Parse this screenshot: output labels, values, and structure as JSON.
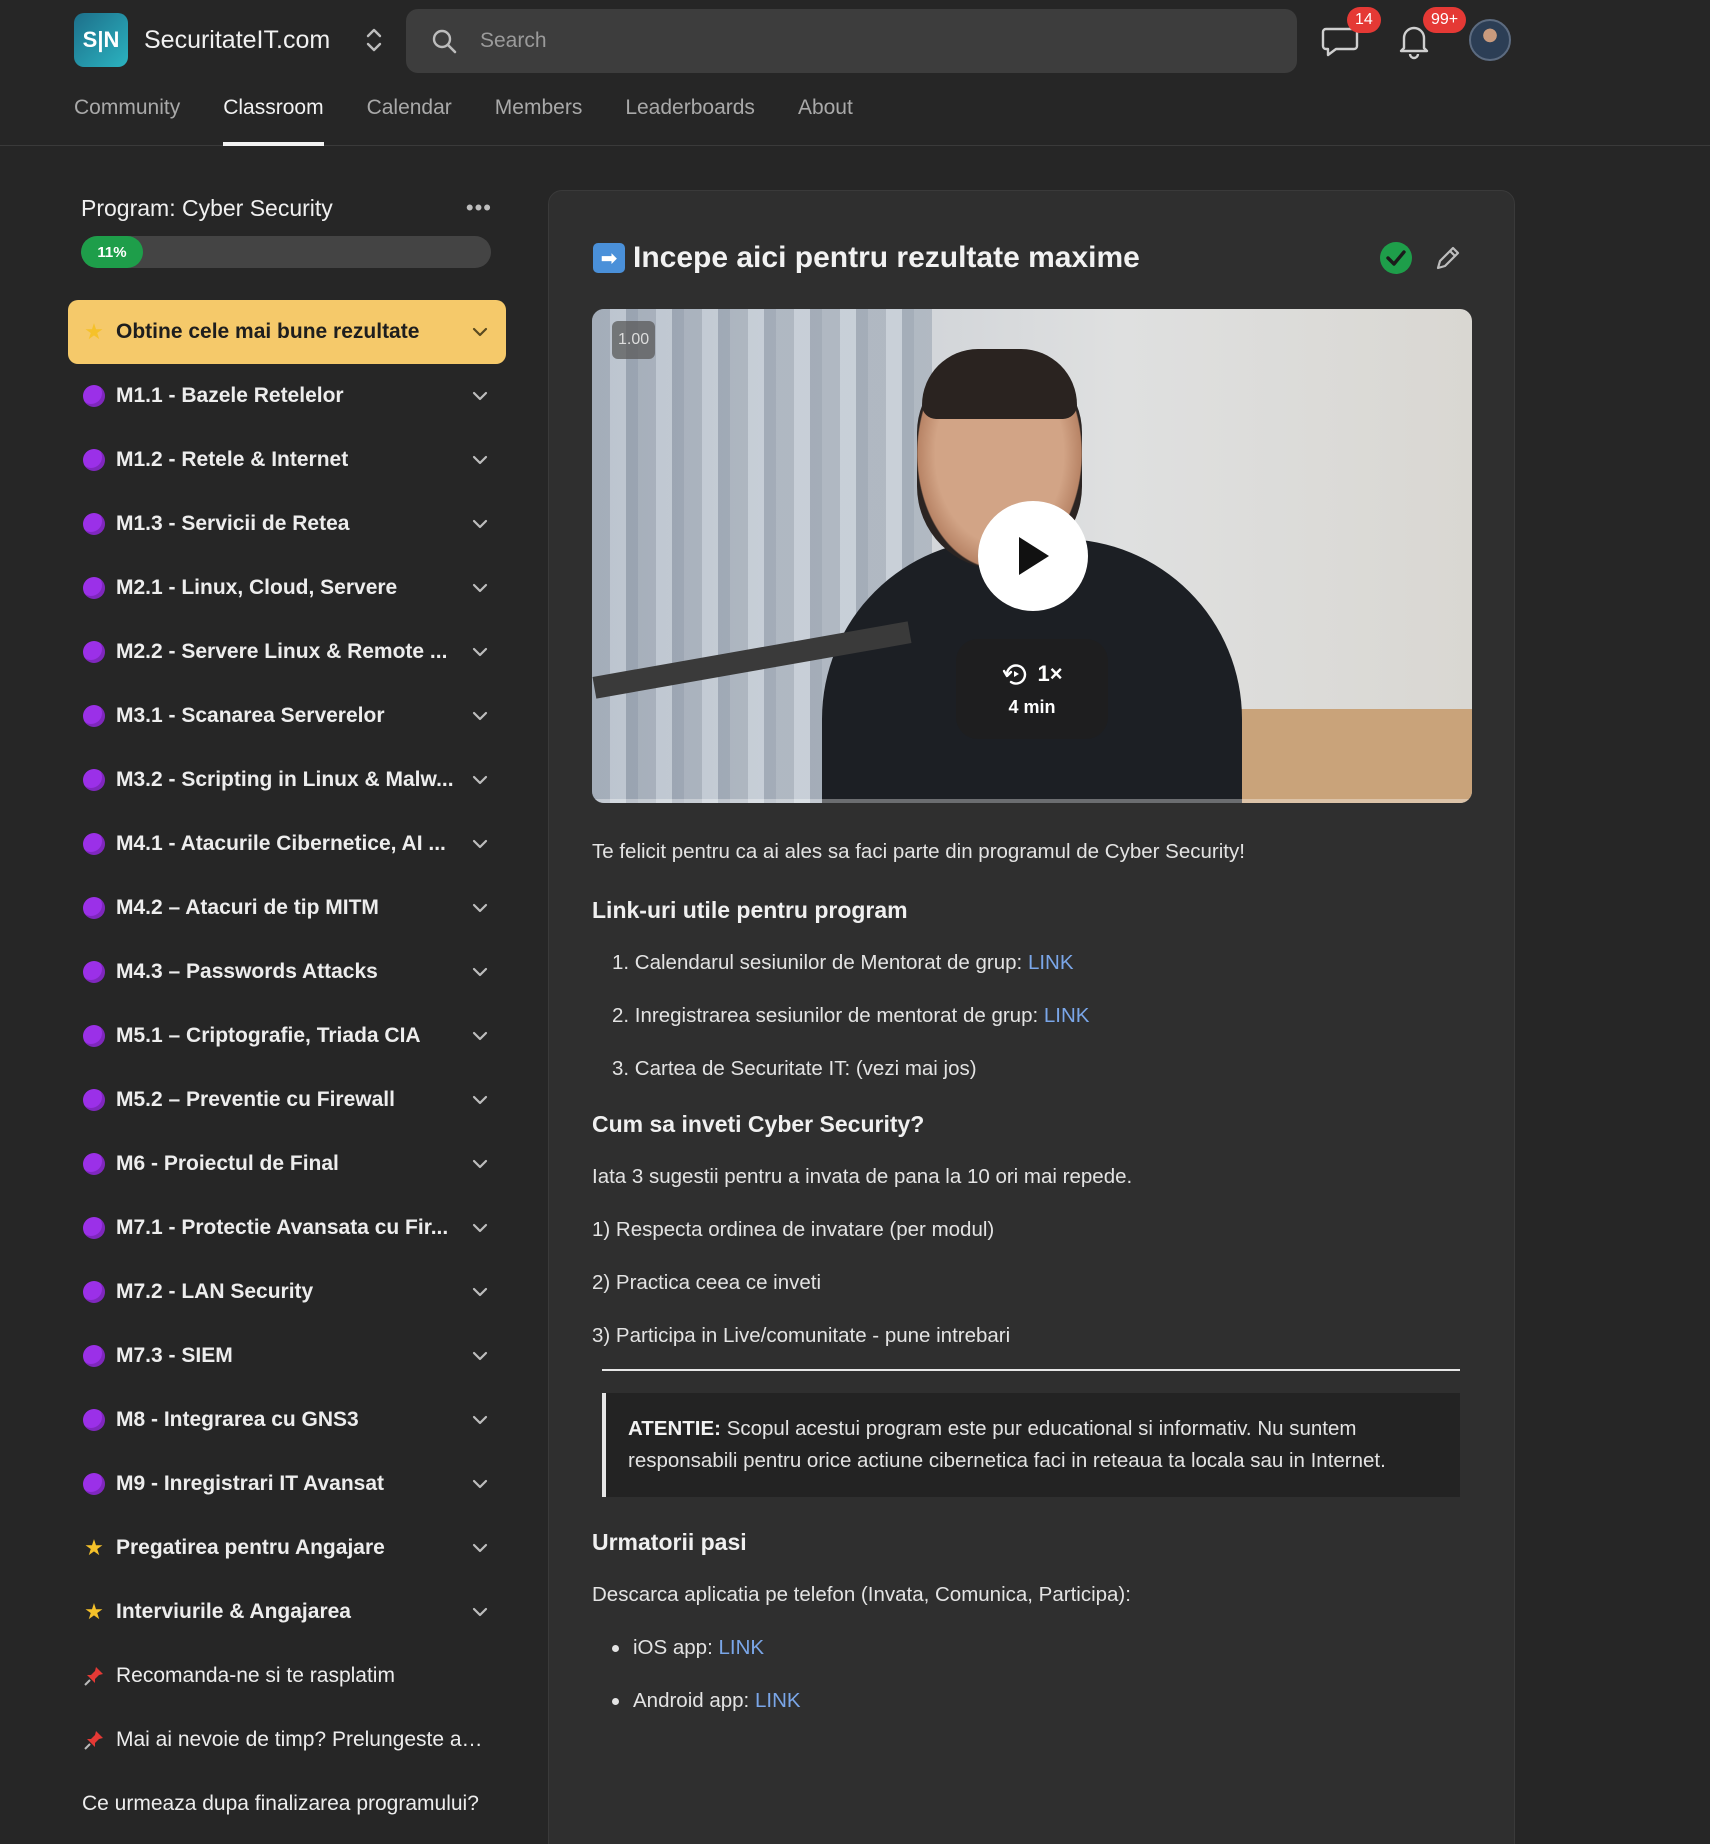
{
  "brand": {
    "name": "SecuritateIT.com",
    "logo_text": "S|N"
  },
  "search": {
    "placeholder": "Search",
    "value": ""
  },
  "header": {
    "chat_badge": "14",
    "notif_badge": "99+"
  },
  "tabs": [
    {
      "label": "Community",
      "active": false
    },
    {
      "label": "Classroom",
      "active": true
    },
    {
      "label": "Calendar",
      "active": false
    },
    {
      "label": "Members",
      "active": false
    },
    {
      "label": "Leaderboards",
      "active": false
    },
    {
      "label": "About",
      "active": false
    }
  ],
  "sidebar": {
    "program_title": "Program: Cyber Security",
    "menu_dots": "•••",
    "progress_label": "11%",
    "progress_value": 0.11,
    "modules": [
      {
        "icon": "star",
        "label": "Obtine cele mai bune rezultate",
        "active": true,
        "expandable": true
      },
      {
        "icon": "purple-circle",
        "label": "M1.1 - Bazele Retelelor",
        "expandable": true
      },
      {
        "icon": "purple-circle",
        "label": "M1.2 - Retele & Internet",
        "expandable": true
      },
      {
        "icon": "purple-circle",
        "label": "M1.3 - Servicii de Retea",
        "expandable": true
      },
      {
        "icon": "purple-circle",
        "label": "M2.1 - Linux, Cloud, Servere",
        "expandable": true
      },
      {
        "icon": "purple-circle",
        "label": "M2.2 - Servere Linux & Remote ...",
        "expandable": true
      },
      {
        "icon": "purple-circle",
        "label": "M3.1 - Scanarea Serverelor",
        "expandable": true
      },
      {
        "icon": "purple-circle",
        "label": "M3.2 - Scripting in Linux & Malw...",
        "expandable": true
      },
      {
        "icon": "purple-circle",
        "label": "M4.1 - Atacurile Cibernetice, AI ...",
        "expandable": true
      },
      {
        "icon": "purple-circle",
        "label": "M4.2 – Atacuri de tip MITM",
        "expandable": true
      },
      {
        "icon": "purple-circle",
        "label": "M4.3 – Passwords Attacks",
        "expandable": true
      },
      {
        "icon": "purple-circle",
        "label": "M5.1 – Criptografie, Triada CIA",
        "expandable": true
      },
      {
        "icon": "purple-circle",
        "label": "M5.2 – Preventie cu Firewall",
        "expandable": true
      },
      {
        "icon": "purple-circle",
        "label": "M6 - Proiectul de Final",
        "expandable": true
      },
      {
        "icon": "purple-circle",
        "label": "M7.1 - Protectie Avansata cu Fir...",
        "expandable": true
      },
      {
        "icon": "purple-circle",
        "label": "M7.2 - LAN Security",
        "expandable": true
      },
      {
        "icon": "purple-circle",
        "label": "M7.3 - SIEM",
        "expandable": true
      },
      {
        "icon": "purple-circle",
        "label": "M8 - Integrarea cu GNS3",
        "expandable": true
      },
      {
        "icon": "purple-circle",
        "label": "M9 - Inregistrari IT Avansat",
        "expandable": true
      },
      {
        "icon": "star",
        "label": "Pregatirea pentru Angajare",
        "expandable": true
      },
      {
        "icon": "star",
        "label": "Interviurile & Angajarea",
        "expandable": true
      },
      {
        "icon": "pin",
        "label": "Recomanda-ne si te rasplatim",
        "expandable": false
      },
      {
        "icon": "pin",
        "label": "Mai ai nevoie de timp? Prelungeste acc...",
        "expandable": false
      },
      {
        "icon": "none",
        "label": "Ce urmeaza dupa finalizarea programului?",
        "expandable": false
      }
    ]
  },
  "lesson": {
    "title": "Incepe aici pentru rezultate maxime",
    "title_emoji": "➡",
    "completed": true,
    "video": {
      "speed_tag": "1.00",
      "rate": "1×",
      "duration": "4 min"
    },
    "intro": "Te felicit pentru ca ai ales sa faci parte din programul de Cyber Security!",
    "links_heading": "Link-uri utile pentru program",
    "links": [
      {
        "text": "1. Calendarul sesiunilor de Mentorat de grup: ",
        "link": "LINK"
      },
      {
        "text": "2. Inregistrarea sesiunilor de mentorat de grup: ",
        "link": "LINK"
      },
      {
        "text": "3. Cartea de Securitate IT: (vezi mai jos)",
        "link": ""
      }
    ],
    "howto_heading": "Cum sa inveti Cyber Security?",
    "howto_intro": "Iata 3 sugestii pentru a invata de pana la 10 ori mai repede.",
    "tips": [
      "1) Respecta ordinea de invatare (per modul)",
      "2) Practica ceea ce inveti",
      "3) Participa in Live/comunitate - pune intrebari"
    ],
    "note_label": "ATENTIE:",
    "note_text": " Scopul acestui program este pur educational si informativ. Nu suntem responsabili pentru orice actiune cibernetica faci in reteaua ta locala sau in Internet.",
    "next_heading": "Urmatorii pasi",
    "next_intro": "Descarca aplicatia pe telefon (Invata, Comunica, Participa):",
    "apps": [
      {
        "text": "iOS app: ",
        "link": "LINK"
      },
      {
        "text": "Android app: ",
        "link": "LINK"
      }
    ]
  },
  "colors": {
    "accent_green": "#1e9e4a",
    "active_module": "#f5c96a",
    "link": "#7aa6e8",
    "badge": "#e53935"
  }
}
